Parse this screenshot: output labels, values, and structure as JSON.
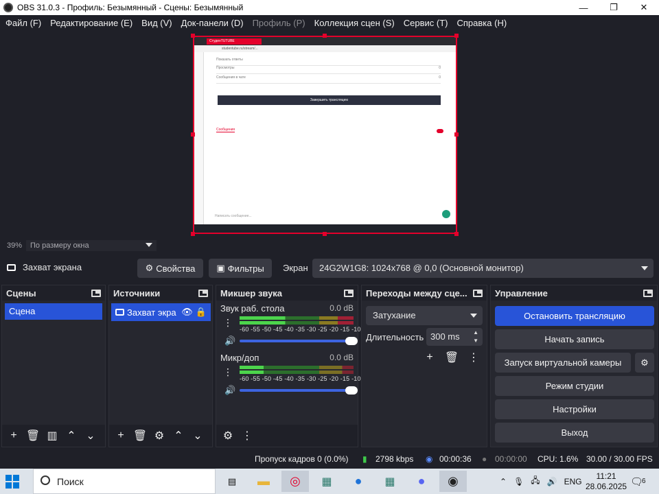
{
  "window": {
    "title": "OBS 31.0.3 - Профиль: Безымянный - Сцены: Безымянный",
    "min": "—",
    "max": "❐",
    "close": "✕"
  },
  "menu": {
    "file": "Файл (F)",
    "edit": "Редактирование (E)",
    "view": "Вид (V)",
    "docks": "Док-панели (D)",
    "profile": "Профиль (P)",
    "scene_collection": "Коллекция сцен (S)",
    "tools": "Сервис (T)",
    "help": "Справка (H)"
  },
  "captured": {
    "tab_title": "СтуденTUTUBE",
    "url": "studentube.ru/stream/...",
    "row1": "Показать ответы",
    "row2": "Просмотры",
    "row2_val": "0",
    "row3": "Сообщения в чате",
    "row3_val": "0",
    "finish_button": "Завершить трансляцию",
    "messages_tab": "Сообщения",
    "chat_placeholder": "Написать сообщение..."
  },
  "zoom": {
    "percent": "39%",
    "mode": "По размеру окна"
  },
  "context": {
    "source_name": "Захват экрана",
    "properties": "Свойства",
    "filters": "Фильтры",
    "screen_label": "Экран",
    "screen_value": "24G2W1G8: 1024x768 @ 0,0 (Основной монитор)"
  },
  "scenes": {
    "title": "Сцены",
    "items": [
      "Сцена"
    ]
  },
  "sources": {
    "title": "Источники",
    "items": [
      "Захват экра"
    ]
  },
  "mixer": {
    "title": "Микшер звука",
    "ticks": "-60 -55 -50 -45 -40 -35 -30 -25 -20 -15 -10 -5  0",
    "channels": [
      {
        "name": "Звук раб. стола",
        "db": "0.0 dB",
        "level": 0.52,
        "volume": 1.0
      },
      {
        "name": "Микр/доп",
        "db": "0.0 dB",
        "level": 0.21,
        "volume": 1.0
      }
    ]
  },
  "transitions": {
    "title": "Переходы между сце...",
    "selected": "Затухание",
    "duration_label": "Длительность",
    "duration_value": "300 ms"
  },
  "controls": {
    "title": "Управление",
    "stop_stream": "Остановить трансляцию",
    "start_record": "Начать запись",
    "virtual_cam": "Запуск виртуальной камеры",
    "studio_mode": "Режим студии",
    "settings": "Настройки",
    "exit": "Выход"
  },
  "status": {
    "dropped": "Пропуск кадров 0 (0.0%)",
    "bitrate": "2798 kbps",
    "stream_time": "00:00:36",
    "record_time": "00:00:00",
    "cpu": "CPU: 1.6%",
    "fps": "30.00 / 30.00 FPS"
  },
  "taskbar": {
    "search": "Поиск",
    "lang": "ENG",
    "time": "11:21",
    "date": "28.06.2025",
    "notifications": "6"
  },
  "colors": {
    "accent": "#2854d8",
    "capture_border": "#e4002b",
    "bg": "#1f2028",
    "panel": "#26272f"
  }
}
